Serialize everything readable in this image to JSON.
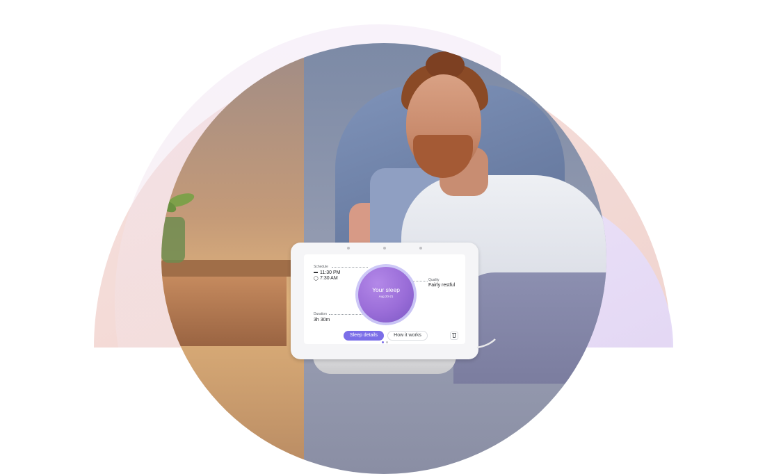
{
  "device_screen": {
    "schedule": {
      "label": "Schedule",
      "bedtime": "11:30 PM",
      "wake": "7:30 AM"
    },
    "quality": {
      "label": "Quality",
      "value": "Fairly restful"
    },
    "duration": {
      "label": "Duration",
      "value": "3h 30m"
    },
    "center": {
      "title": "Your sleep",
      "date": "Aug 20-21"
    },
    "buttons": {
      "primary": "Sleep details",
      "secondary": "How it works"
    },
    "page_dots": 2
  },
  "icons": [
    "bed-icon",
    "alarm-clock-icon",
    "delete-icon"
  ],
  "colors": {
    "accent": "#7b6ee8",
    "arc_pink": "#f6d6d0",
    "arc_lavender": "#e6dcf7"
  }
}
